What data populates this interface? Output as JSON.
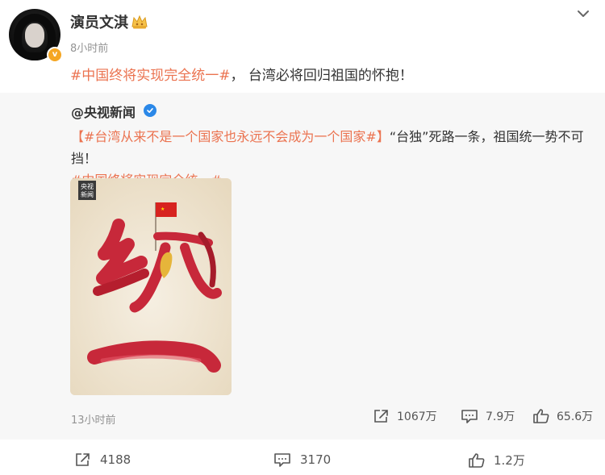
{
  "post": {
    "author": "演员文淇",
    "avatar_badge": "v",
    "time": "8小时前",
    "text": {
      "hashtag": "#中国终将实现完全统一#",
      "body": "， 台湾必将回归祖国的怀抱！"
    }
  },
  "repost": {
    "source": "@央视新闻",
    "text": {
      "open_bracket": "【",
      "hashtag1": "#台湾从来不是一个国家也永远不会成为一个国家#",
      "close_bracket": "】",
      "body": "“台独”死路一条，祖国统一势不可挡！",
      "hashtag2": "#中国终将实现完全统一#"
    },
    "image": {
      "logo_line1": "央视",
      "logo_line2": "新闻",
      "calligraphy": "统一"
    },
    "time": "13小时前",
    "stats": {
      "shares": "1067万",
      "comments": "7.9万",
      "likes": "65.6万"
    }
  },
  "footer": {
    "shares": "4188",
    "comments": "3170",
    "likes": "1.2万"
  },
  "colors": {
    "hashtag": "#eb7350",
    "verified_orange": "#f5a623",
    "verified_blue": "#2b88e8",
    "calligraphy_red": "#c7283a"
  },
  "icons": [
    "crown-icon",
    "chevron-down-icon",
    "verified-icon",
    "share-icon",
    "comment-icon",
    "like-icon"
  ]
}
